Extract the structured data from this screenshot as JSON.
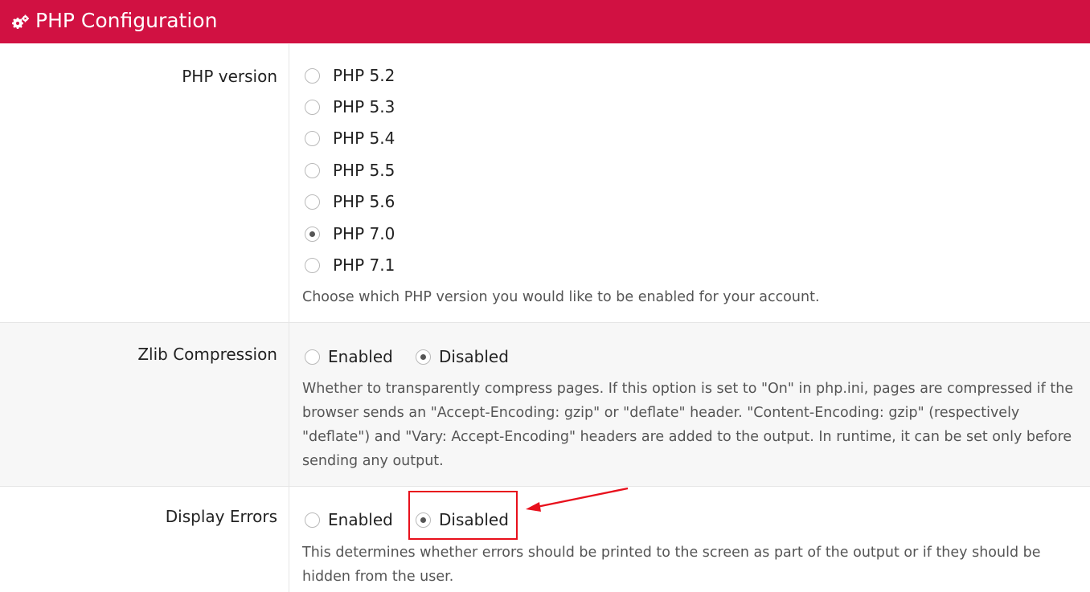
{
  "header": {
    "title": "PHP Configuration",
    "icon": "gears-icon"
  },
  "php_version": {
    "label": "PHP version",
    "options": [
      "PHP 5.2",
      "PHP 5.3",
      "PHP 5.4",
      "PHP 5.5",
      "PHP 5.6",
      "PHP 7.0",
      "PHP 7.1"
    ],
    "selected": "PHP 7.0",
    "help": "Choose which PHP version you would like to be enabled for your account."
  },
  "zlib": {
    "label": "Zlib Compression",
    "enabled_label": "Enabled",
    "disabled_label": "Disabled",
    "selected": "Disabled",
    "help": "Whether to transparently compress pages. If this option is set to \"On\" in php.ini, pages are compressed if the browser sends an \"Accept-Encoding: gzip\" or \"deflate\" header. \"Content-Encoding: gzip\" (respectively \"deflate\") and \"Vary: Accept-Encoding\" headers are added to the output. In runtime, it can be set only before sending any output."
  },
  "display_errors": {
    "label": "Display Errors",
    "enabled_label": "Enabled",
    "disabled_label": "Disabled",
    "selected": "Disabled",
    "help": "This determines whether errors should be printed to the screen as part of the output or if they should be hidden from the user."
  },
  "colors": {
    "header_bg": "#d11142",
    "annotation": "#e8101c"
  }
}
